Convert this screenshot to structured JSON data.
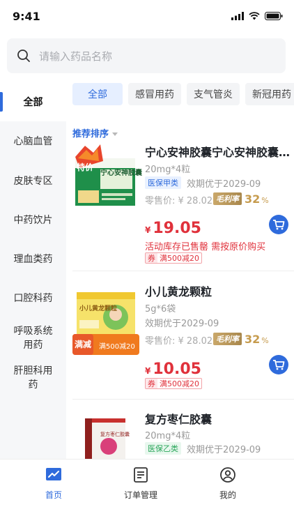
{
  "status_bar": {
    "time": "9:41"
  },
  "search": {
    "placeholder": "请输入药品名称"
  },
  "categories": [
    "全部",
    "心脑血管",
    "皮肤专区",
    "中药饮片",
    "理血类药",
    "口腔科药",
    "呼吸系统用药",
    "肝胆科用药"
  ],
  "tabs": [
    "全部",
    "感冒用药",
    "支气管炎",
    "新冠用药"
  ],
  "sort_label": "推荐排序",
  "products": [
    {
      "name": "宁心安神胶囊宁心安神胶囊...",
      "spec": "20mg*4粒",
      "insurance": "医保甲类",
      "expiry": "效期优于2029-09",
      "retail": "零售价: ¥ 28.02",
      "margin_label": "毛利率",
      "margin_value": "32",
      "margin_unit": "%",
      "price_symbol": "¥",
      "price": "19.05",
      "stock_message": "活动库存已售罄 需按原价购买",
      "coupon_label": "券",
      "coupon_text": "满500减20",
      "image_text": "宁心安神胶囊",
      "image_badge": "特价"
    },
    {
      "name": "小儿黄龙颗粒",
      "spec": "5g*6袋",
      "expiry": "效期优于2029-09",
      "retail": "零售价: ¥ 28.02",
      "margin_label": "毛利率",
      "margin_value": "32",
      "margin_unit": "%",
      "price_symbol": "¥",
      "price": "10.05",
      "coupon_label": "券",
      "coupon_text": "满500减20",
      "image_text": "小儿黄龙颗粒",
      "image_badge": "满减",
      "image_badge_detail": "满500减20"
    },
    {
      "name": "复方枣仁胶囊",
      "spec": "20mg*4粒",
      "insurance": "医保乙类",
      "expiry": "效期优于2029-09",
      "image_text": "复方枣仁胶囊"
    }
  ],
  "bottom_tabs": [
    "首页",
    "订单管理",
    "我的"
  ],
  "colors": {
    "accent": "#2f6bdc",
    "price": "#e0313b",
    "margin": "#c69b4d"
  }
}
